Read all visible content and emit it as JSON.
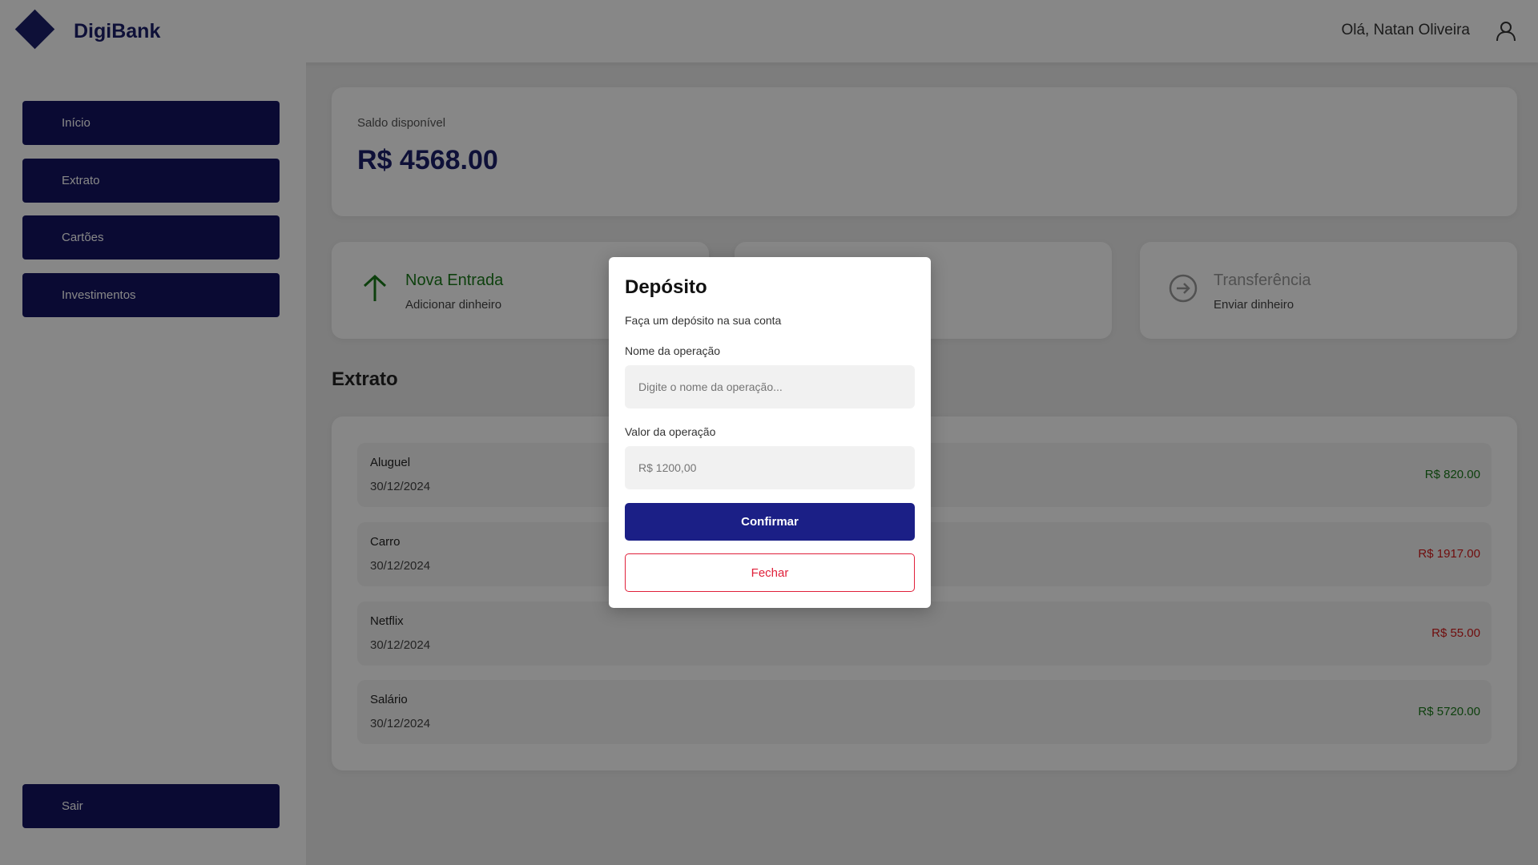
{
  "header": {
    "brand": "DigiBank",
    "greeting": "Olá, Natan Oliveira",
    "logo_icon": "diamond-logo-icon",
    "user_icon": "user-icon"
  },
  "sidebar": {
    "items": [
      {
        "label": "Início"
      },
      {
        "label": "Extrato"
      },
      {
        "label": "Cartões"
      },
      {
        "label": "Investimentos"
      }
    ],
    "logout_label": "Sair"
  },
  "balance": {
    "label": "Saldo disponível",
    "value": "R$ 4568.00"
  },
  "actions": [
    {
      "title": "Nova Entrada",
      "subtitle": "Adicionar dinheiro",
      "icon": "arrow-up-icon"
    },
    {
      "title": "",
      "subtitle": "",
      "icon": ""
    },
    {
      "title": "Transferência",
      "subtitle": "Enviar dinheiro",
      "icon": "arrow-right-circle-icon"
    }
  ],
  "extrato": {
    "title": "Extrato",
    "transactions": [
      {
        "name": "Aluguel",
        "date": "30/12/2024",
        "amount": "R$ 820.00",
        "type": "positive"
      },
      {
        "name": "Carro",
        "date": "30/12/2024",
        "amount": "R$ 1917.00",
        "type": "negative"
      },
      {
        "name": "Netflix",
        "date": "30/12/2024",
        "amount": "R$ 55.00",
        "type": "negative"
      },
      {
        "name": "Salário",
        "date": "30/12/2024",
        "amount": "R$ 5720.00",
        "type": "positive"
      }
    ]
  },
  "modal": {
    "title": "Depósito",
    "description": "Faça um depósito na sua conta",
    "name_label": "Nome da operação",
    "name_placeholder": "Digite o nome da operação...",
    "value_label": "Valor da operação",
    "value_placeholder": "R$ 1200,00",
    "confirm_label": "Confirmar",
    "close_label": "Fechar"
  },
  "colors": {
    "brand": "#1b1f6b",
    "sidebar_button": "#131460",
    "positive": "#1a7a1a",
    "negative": "#d41a1a",
    "confirm": "#1b1f86",
    "close": "#e0203a"
  }
}
